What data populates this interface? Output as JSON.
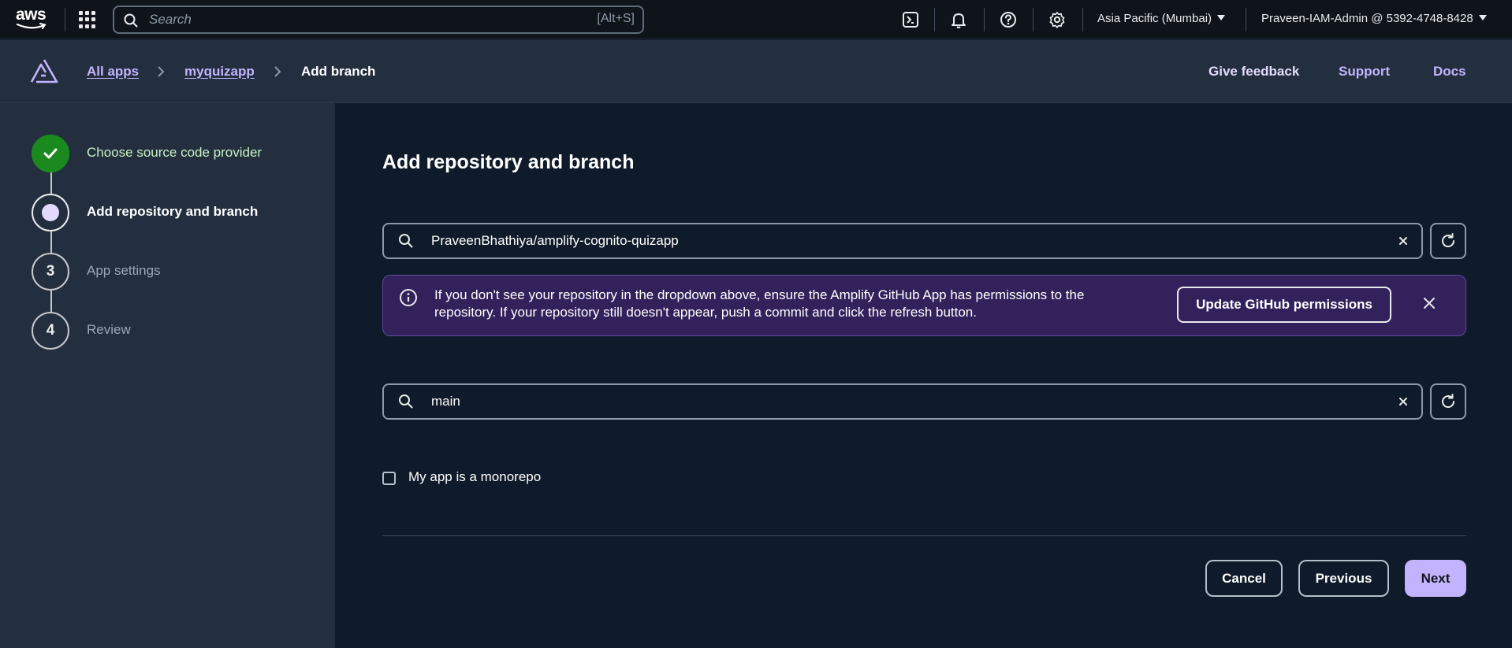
{
  "topbar": {
    "logo_text": "aws",
    "search_placeholder": "Search",
    "search_shortcut": "[Alt+S]",
    "region": "Asia Pacific (Mumbai)",
    "account": "Praveen-IAM-Admin @ 5392-4748-8428"
  },
  "header": {
    "breadcrumbs": [
      {
        "label": "All apps"
      },
      {
        "label": "myquizapp"
      },
      {
        "label": "Add branch"
      }
    ],
    "links": {
      "feedback": "Give feedback",
      "support": "Support",
      "docs": "Docs"
    }
  },
  "steps": [
    {
      "label": "Choose source code provider",
      "state": "completed"
    },
    {
      "label": "Add repository and branch",
      "state": "current"
    },
    {
      "number": "3",
      "label": "App settings",
      "state": "upcoming"
    },
    {
      "number": "4",
      "label": "Review",
      "state": "upcoming"
    }
  ],
  "main": {
    "title": "Add repository and branch",
    "repository_value": "PraveenBhathiya/amplify-cognito-quizapp",
    "branch_value": "main",
    "alert": {
      "message": "If you don't see your repository in the dropdown above, ensure the Amplify GitHub App has permissions to the repository. If your repository still doesn't appear, push a commit and click the refresh button.",
      "button_label": "Update GitHub permissions"
    },
    "monorepo_label": "My app is a monorepo",
    "monorepo_checked": false
  },
  "footer": {
    "cancel": "Cancel",
    "previous": "Previous",
    "next": "Next"
  },
  "colors": {
    "accent": "#c2b4fc",
    "success": "#1a8a1f",
    "alert_bg": "#33215b",
    "page_bg": "#0f1b2a",
    "panel_bg": "#232f3e"
  }
}
